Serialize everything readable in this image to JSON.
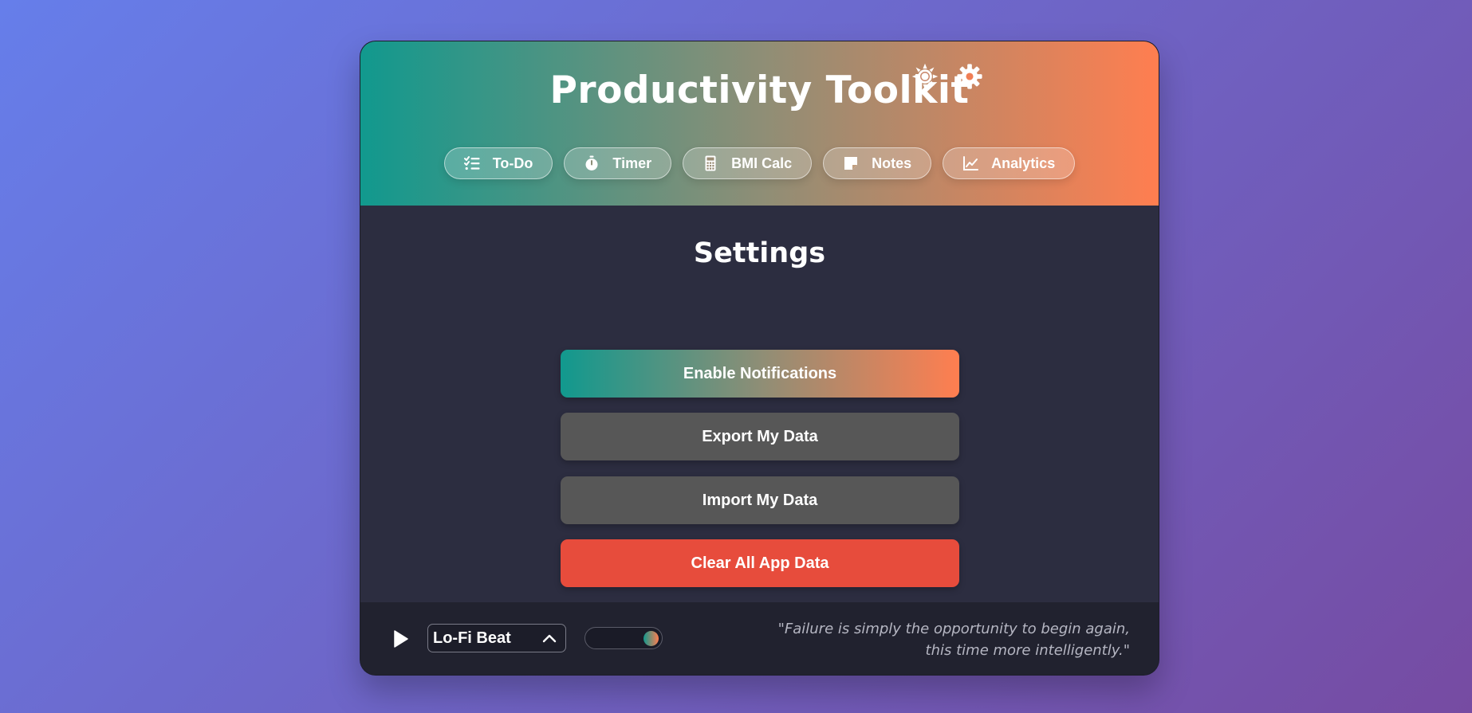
{
  "header": {
    "title": "Productivity Toolkit",
    "icons": [
      "theme-toggle-icon",
      "settings-gear-icon"
    ]
  },
  "nav": {
    "items": [
      {
        "label": "To-Do",
        "icon": "checklist-icon"
      },
      {
        "label": "Timer",
        "icon": "stopwatch-icon"
      },
      {
        "label": "BMI Calc",
        "icon": "calculator-icon"
      },
      {
        "label": "Notes",
        "icon": "sticky-note-icon"
      },
      {
        "label": "Analytics",
        "icon": "line-chart-icon"
      }
    ]
  },
  "settings": {
    "title": "Settings",
    "enable_notifications": "Enable Notifications",
    "export_data": "Export My Data",
    "import_data": "Import My Data",
    "clear_data": "Clear All App Data"
  },
  "footer": {
    "track": "Lo-Fi Beat",
    "volume_level": 1.0,
    "quote_line1": "\"Failure is simply the opportunity to begin again,",
    "quote_line2": "this time more intelligently.\""
  },
  "colors": {
    "accent_start": "#11998e",
    "accent_end": "#ff7e50",
    "danger": "#e74c3c",
    "panel": "#2c2d40",
    "footer": "#21222f"
  }
}
